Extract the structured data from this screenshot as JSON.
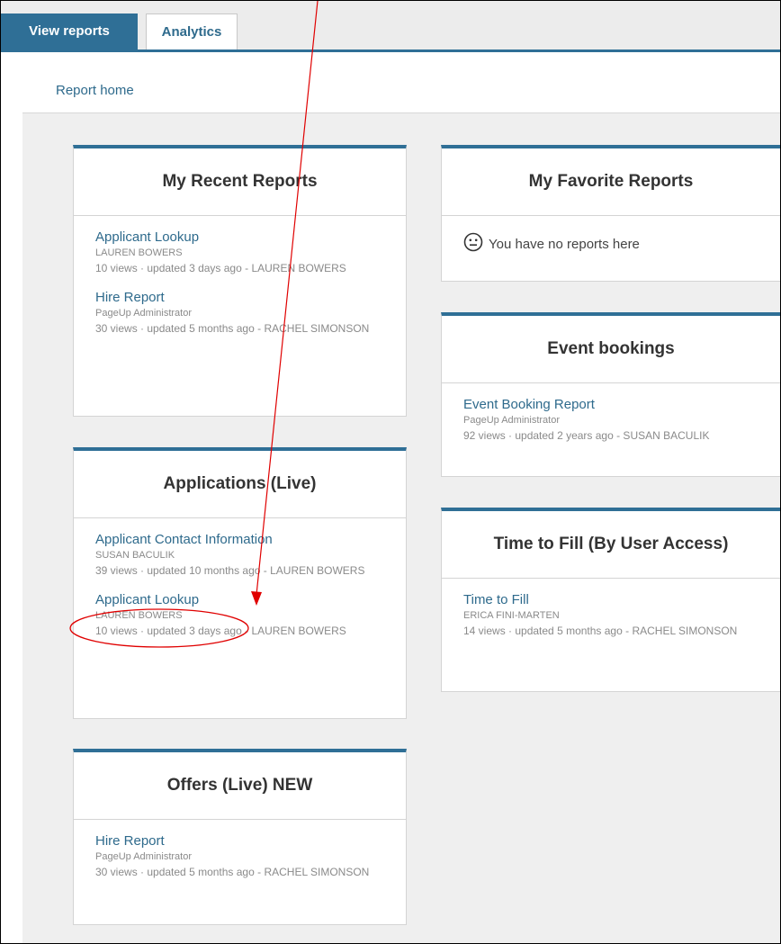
{
  "tabs": [
    {
      "label": "View reports",
      "active": true
    },
    {
      "label": "Analytics",
      "active": false
    }
  ],
  "breadcrumb": "Report home",
  "left_cards": [
    {
      "title": "My Recent Reports",
      "items": [
        {
          "title": "Applicant Lookup",
          "owner": "LAUREN BOWERS",
          "meta": "10 views · updated 3 days ago - LAUREN BOWERS"
        },
        {
          "title": "Hire Report",
          "owner": "PageUp Administrator",
          "meta": "30 views · updated 5 months ago - RACHEL SIMONSON"
        }
      ]
    },
    {
      "title": "Applications (Live)",
      "items": [
        {
          "title": "Applicant Contact Information",
          "owner": "SUSAN BACULIK",
          "meta": "39 views · updated 10 months ago - LAUREN BOWERS"
        },
        {
          "title": "Applicant Lookup",
          "owner": "LAUREN BOWERS",
          "meta": "10 views · updated 3 days ago - LAUREN BOWERS"
        }
      ]
    },
    {
      "title": "Offers (Live) NEW",
      "items": [
        {
          "title": "Hire Report",
          "owner": "PageUp Administrator",
          "meta": "30 views · updated 5 months ago - RACHEL SIMONSON"
        }
      ]
    }
  ],
  "right_cards": [
    {
      "title": "My Favorite Reports",
      "empty_text": "You have no reports here",
      "empty_icon": "neutral-face-icon"
    },
    {
      "title": "Event bookings",
      "items": [
        {
          "title": "Event Booking Report",
          "owner": "PageUp Administrator",
          "meta": "92 views · updated 2 years ago - SUSAN BACULIK"
        }
      ]
    },
    {
      "title": "Time to Fill (By User Access)",
      "items": [
        {
          "title": "Time to Fill",
          "owner": "ERICA FINI-MARTEN",
          "meta": "14 views · updated 5 months ago - RACHEL SIMONSON"
        }
      ]
    }
  ],
  "annotation": {
    "color": "#e00000"
  }
}
